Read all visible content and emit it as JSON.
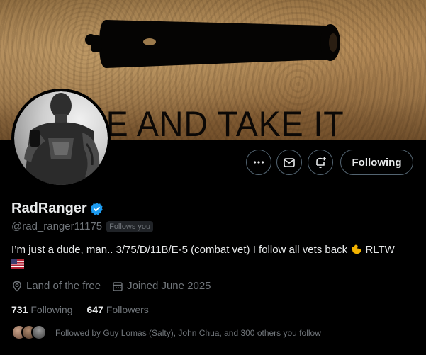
{
  "banner": {
    "text": "ME AND TAKE IT"
  },
  "profile": {
    "display_name": "RadRanger",
    "handle": "@rad_ranger11175",
    "follows_you": "Follows you",
    "bio_text": "I’m just a dude, man..  3/75/D/11B/E-5 (combat vet) I follow all vets back",
    "bio_suffix": "RLTW",
    "location": "Land of the free",
    "joined": "Joined June 2025",
    "verified_color": "#1d9bf0"
  },
  "actions": {
    "more_icon": "more-icon",
    "message_icon": "message-icon",
    "notify_icon": "notify-icon",
    "following_label": "Following"
  },
  "stats": {
    "following_count": "731",
    "following_label": "Following",
    "followers_count": "647",
    "followers_label": "Followers"
  },
  "followed_by": {
    "text": "Followed by Guy Lomas (Salty), John Chua, and 300 others you follow"
  }
}
